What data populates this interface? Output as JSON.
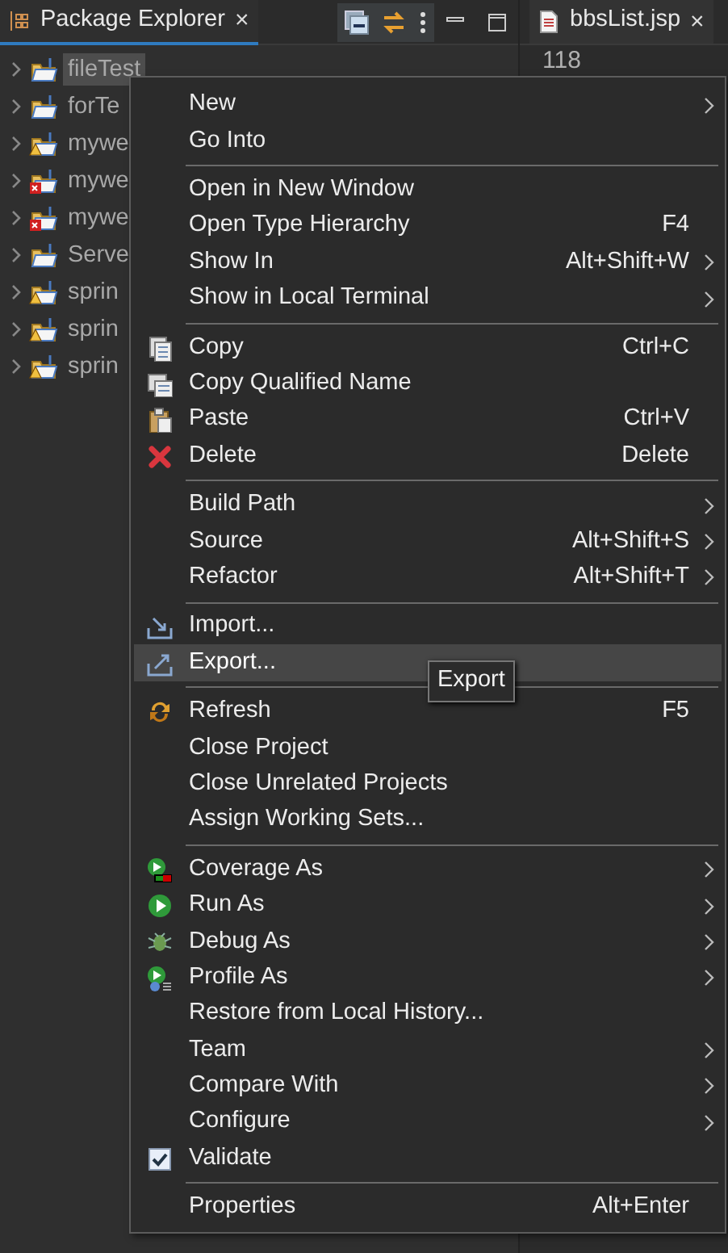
{
  "explorer": {
    "tab": {
      "label": "Package Explorer",
      "close": "×",
      "selected": true
    },
    "tree": [
      {
        "label": "fileTest",
        "selected": true,
        "kind": "plain"
      },
      {
        "label": "forTe",
        "selected": false,
        "kind": "plain"
      },
      {
        "label": "mywe",
        "selected": false,
        "kind": "warning"
      },
      {
        "label": "mywe",
        "selected": false,
        "kind": "error"
      },
      {
        "label": "mywe",
        "selected": false,
        "kind": "error"
      },
      {
        "label": "Serve",
        "selected": false,
        "kind": "plain"
      },
      {
        "label": "sprin",
        "selected": false,
        "kind": "warning"
      },
      {
        "label": "sprin",
        "selected": false,
        "kind": "warning"
      },
      {
        "label": "sprin",
        "selected": false,
        "kind": "warning"
      }
    ]
  },
  "editor": {
    "tab": {
      "label": "bbsList.jsp",
      "close": "×"
    },
    "line_text": "118"
  },
  "context_menu": {
    "items": [
      {
        "kind": "item",
        "label": "New",
        "submenu": true,
        "highlighted": false
      },
      {
        "kind": "item",
        "label": "Go Into",
        "submenu": false,
        "highlighted": false
      },
      {
        "kind": "separator"
      },
      {
        "kind": "item",
        "label": "Open in New Window",
        "submenu": false,
        "highlighted": false
      },
      {
        "kind": "item",
        "label": "Open Type Hierarchy",
        "shortcut": "F4",
        "submenu": false,
        "highlighted": false
      },
      {
        "kind": "item",
        "label": "Show In",
        "shortcut": "Alt+Shift+W",
        "submenu": true,
        "highlighted": false
      },
      {
        "kind": "item",
        "label": "Show in Local Terminal",
        "submenu": true,
        "highlighted": false
      },
      {
        "kind": "separator"
      },
      {
        "kind": "copy",
        "label": "Copy",
        "shortcut": "Ctrl+C",
        "submenu": false,
        "highlighted": false
      },
      {
        "kind": "clone",
        "label": "Copy Qualified Name",
        "submenu": false,
        "highlighted": false
      },
      {
        "kind": "paste",
        "label": "Paste",
        "shortcut": "Ctrl+V",
        "submenu": false,
        "highlighted": false
      },
      {
        "kind": "delete",
        "label": "Delete",
        "shortcut": "Delete",
        "submenu": false,
        "highlighted": false
      },
      {
        "kind": "separator"
      },
      {
        "kind": "item",
        "label": "Build Path",
        "submenu": true,
        "highlighted": false
      },
      {
        "kind": "item",
        "label": "Source",
        "shortcut": "Alt+Shift+S",
        "submenu": true,
        "highlighted": false
      },
      {
        "kind": "item",
        "label": "Refactor",
        "shortcut": "Alt+Shift+T",
        "submenu": true,
        "highlighted": false
      },
      {
        "kind": "separator"
      },
      {
        "kind": "import",
        "label": "Import...",
        "submenu": false,
        "highlighted": false
      },
      {
        "kind": "export",
        "label": "Export...",
        "submenu": false,
        "highlighted": true
      },
      {
        "kind": "separator"
      },
      {
        "kind": "refresh",
        "label": "Refresh",
        "shortcut": "F5",
        "submenu": false,
        "highlighted": false
      },
      {
        "kind": "item",
        "label": "Close Project",
        "submenu": false,
        "highlighted": false
      },
      {
        "kind": "item",
        "label": "Close Unrelated Projects",
        "submenu": false,
        "highlighted": false
      },
      {
        "kind": "item",
        "label": "Assign Working Sets...",
        "submenu": false,
        "highlighted": false
      },
      {
        "kind": "separator"
      },
      {
        "kind": "coverage",
        "label": "Coverage As",
        "submenu": true,
        "highlighted": false
      },
      {
        "kind": "run",
        "label": "Run As",
        "submenu": true,
        "highlighted": false
      },
      {
        "kind": "debug",
        "label": "Debug As",
        "submenu": true,
        "highlighted": false
      },
      {
        "kind": "profile",
        "label": "Profile As",
        "submenu": true,
        "highlighted": false
      },
      {
        "kind": "item",
        "label": "Restore from Local History...",
        "submenu": false,
        "highlighted": false
      },
      {
        "kind": "item",
        "label": "Team",
        "submenu": true,
        "highlighted": false
      },
      {
        "kind": "item",
        "label": "Compare With",
        "submenu": true,
        "highlighted": false
      },
      {
        "kind": "item",
        "label": "Configure",
        "submenu": true,
        "highlighted": false
      },
      {
        "kind": "check",
        "label": "Validate",
        "checked": true,
        "submenu": false,
        "highlighted": false
      },
      {
        "kind": "separator"
      },
      {
        "kind": "item",
        "label": "Properties",
        "shortcut": "Alt+Enter",
        "submenu": false,
        "highlighted": false
      }
    ]
  },
  "tooltip": {
    "text": "Export"
  }
}
